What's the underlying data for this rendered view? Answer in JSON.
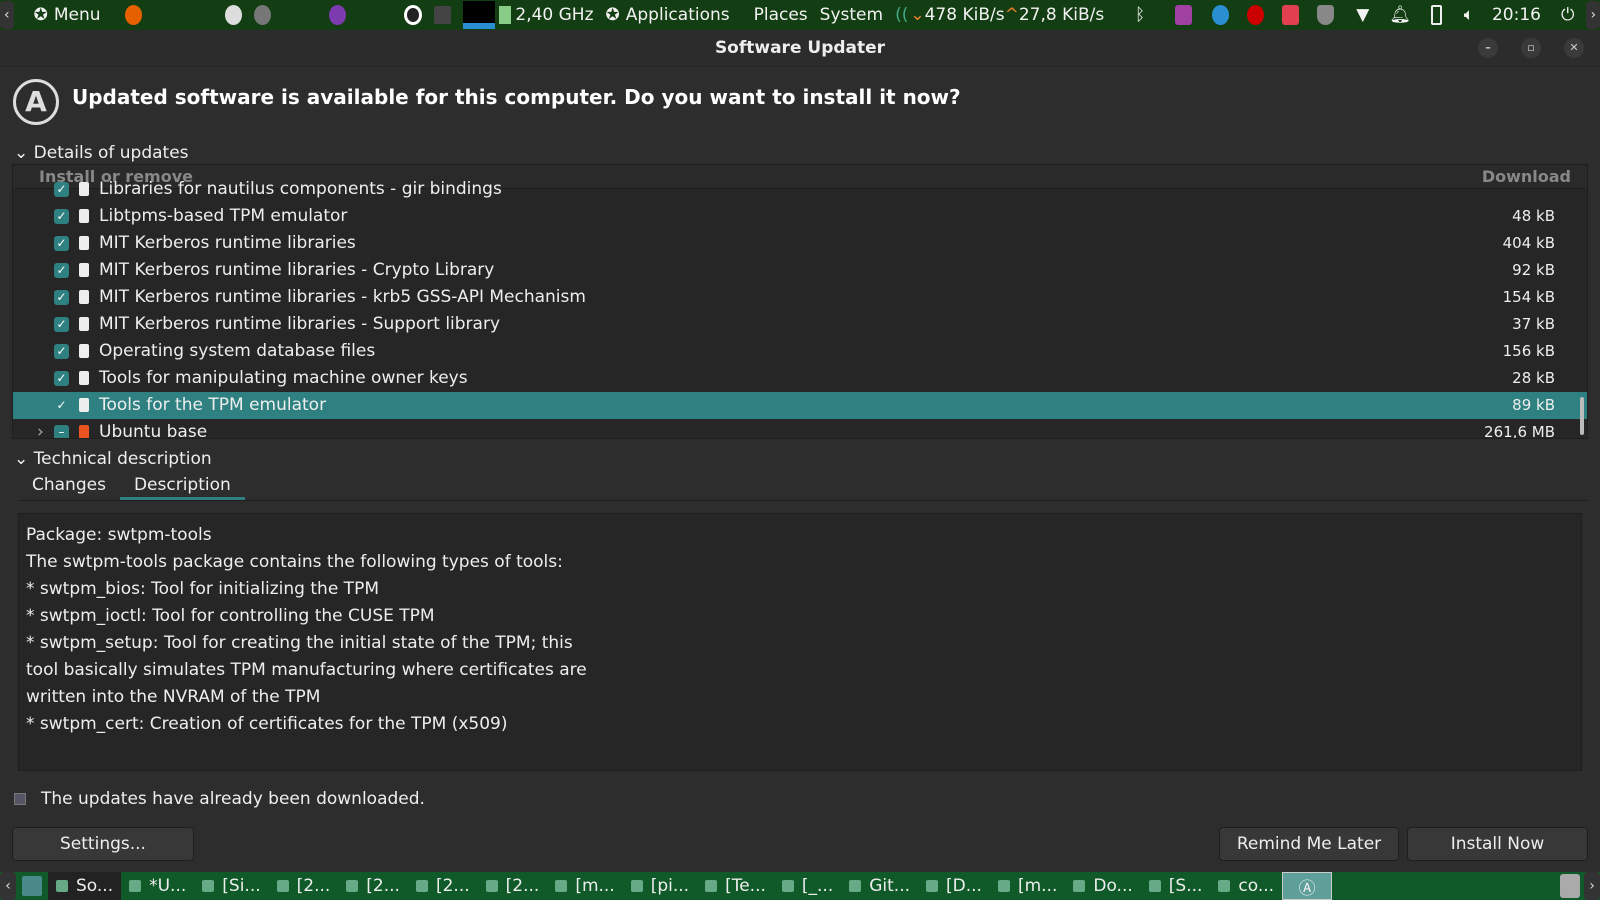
{
  "top_panel": {
    "menu": "Menu",
    "cpu_freq": "2,40 GHz",
    "applications": "Applications",
    "places": "Places",
    "system": "System",
    "net_down": "478 KiB/s",
    "net_up": "27,8 KiB/s",
    "clock": "20:16"
  },
  "window": {
    "title": "Software Updater"
  },
  "header": {
    "message": "Updated software is available for this computer. Do you want to install it now?"
  },
  "details": {
    "label": "Details of updates",
    "col_install": "Install or remove",
    "col_download": "Download",
    "rows": [
      {
        "name": "Libraries for nautilus components - gir bindings",
        "size": "",
        "checked": true
      },
      {
        "name": "Libtpms-based TPM emulator",
        "size": "48 kB",
        "checked": true
      },
      {
        "name": "MIT Kerberos runtime libraries",
        "size": "404 kB",
        "checked": true
      },
      {
        "name": "MIT Kerberos runtime libraries - Crypto Library",
        "size": "92 kB",
        "checked": true
      },
      {
        "name": "MIT Kerberos runtime libraries - krb5 GSS-API Mechanism",
        "size": "154 kB",
        "checked": true
      },
      {
        "name": "MIT Kerberos runtime libraries - Support library",
        "size": "37 kB",
        "checked": true
      },
      {
        "name": "Operating system database files",
        "size": "156 kB",
        "checked": true
      },
      {
        "name": "Tools for manipulating machine owner keys",
        "size": "28 kB",
        "checked": true
      },
      {
        "name": "Tools for the TPM emulator",
        "size": "89 kB",
        "checked": true,
        "selected": true
      },
      {
        "name": "Ubuntu base",
        "size": "261,6 MB",
        "checked": "partial"
      }
    ]
  },
  "technical": {
    "label": "Technical description",
    "tabs": [
      "Changes",
      "Description"
    ],
    "active_tab": "Description",
    "lines": [
      "Package: swtpm-tools",
      "The swtpm-tools package contains the following types of tools:",
      "* swtpm_bios: Tool for initializing the TPM",
      "* swtpm_ioctl: Tool for controlling the CUSE TPM",
      "* swtpm_setup: Tool for creating the initial state of the TPM; this",
      "tool basically simulates TPM manufacturing where certificates are",
      "written into the NVRAM of the TPM",
      "* swtpm_cert: Creation of certificates for the TPM (x509)"
    ]
  },
  "status": "The updates have already been downloaded.",
  "buttons": {
    "settings": "Settings...",
    "remind": "Remind Me Later",
    "install": "Install Now"
  },
  "taskbar": [
    "So...",
    "*U...",
    "[Si...",
    "[2...",
    "[2...",
    "[2...",
    "[2...",
    "[m...",
    "[pi...",
    "[Te...",
    "[_...",
    "Git...",
    "[D...",
    "[m...",
    "Do...",
    "[S...",
    "co..."
  ]
}
